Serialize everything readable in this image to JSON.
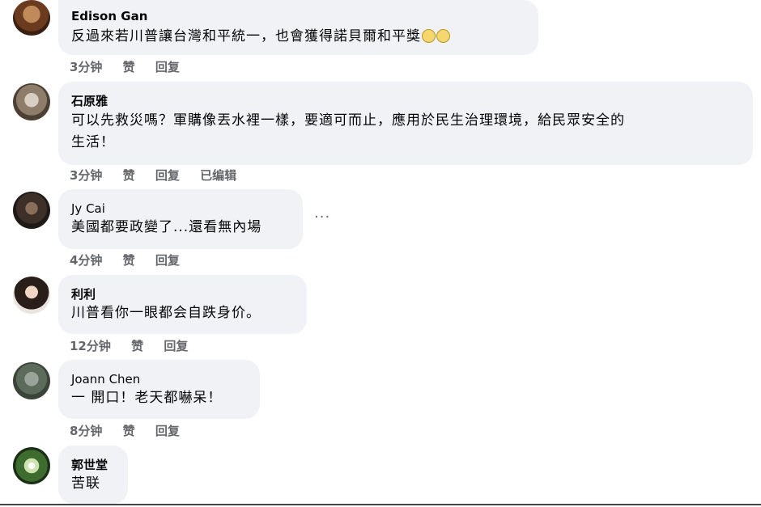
{
  "comments": [
    {
      "author": "Edison Gan",
      "text": "反過來若川普讓台灣和平統一，也會獲得諾貝爾和平獎",
      "emoji": "crying-face-emoji",
      "time": "3分钟",
      "like": "赞",
      "reply": "回复",
      "edited": ""
    },
    {
      "author": "石原雅",
      "text_line1": "可以先救災嗎？軍購像丟水裡一樣，要適可而止，應用於民生治理環境，給民眾安全的",
      "text_line2": "生活！",
      "time": "3分钟",
      "like": "赞",
      "reply": "回复",
      "edited": "已编辑"
    },
    {
      "author": "Jy Cai",
      "text": "美國都要政變了...還看無內場",
      "time": "4分钟",
      "like": "赞",
      "reply": "回复",
      "more": "···"
    },
    {
      "author": "利利",
      "text": "川普看你一眼都会自跌身价。",
      "time": "12分钟",
      "like": "赞",
      "reply": "回复"
    },
    {
      "author": "Joann Chen",
      "text": "一 開口！老天都嚇呆！",
      "time": "8分钟",
      "like": "赞",
      "reply": "回复"
    },
    {
      "author": "郭世堂",
      "text": "苦联"
    }
  ],
  "colors": {
    "bubble": "#f0f2f5",
    "meta_text": "#65676b",
    "text": "#050505"
  }
}
